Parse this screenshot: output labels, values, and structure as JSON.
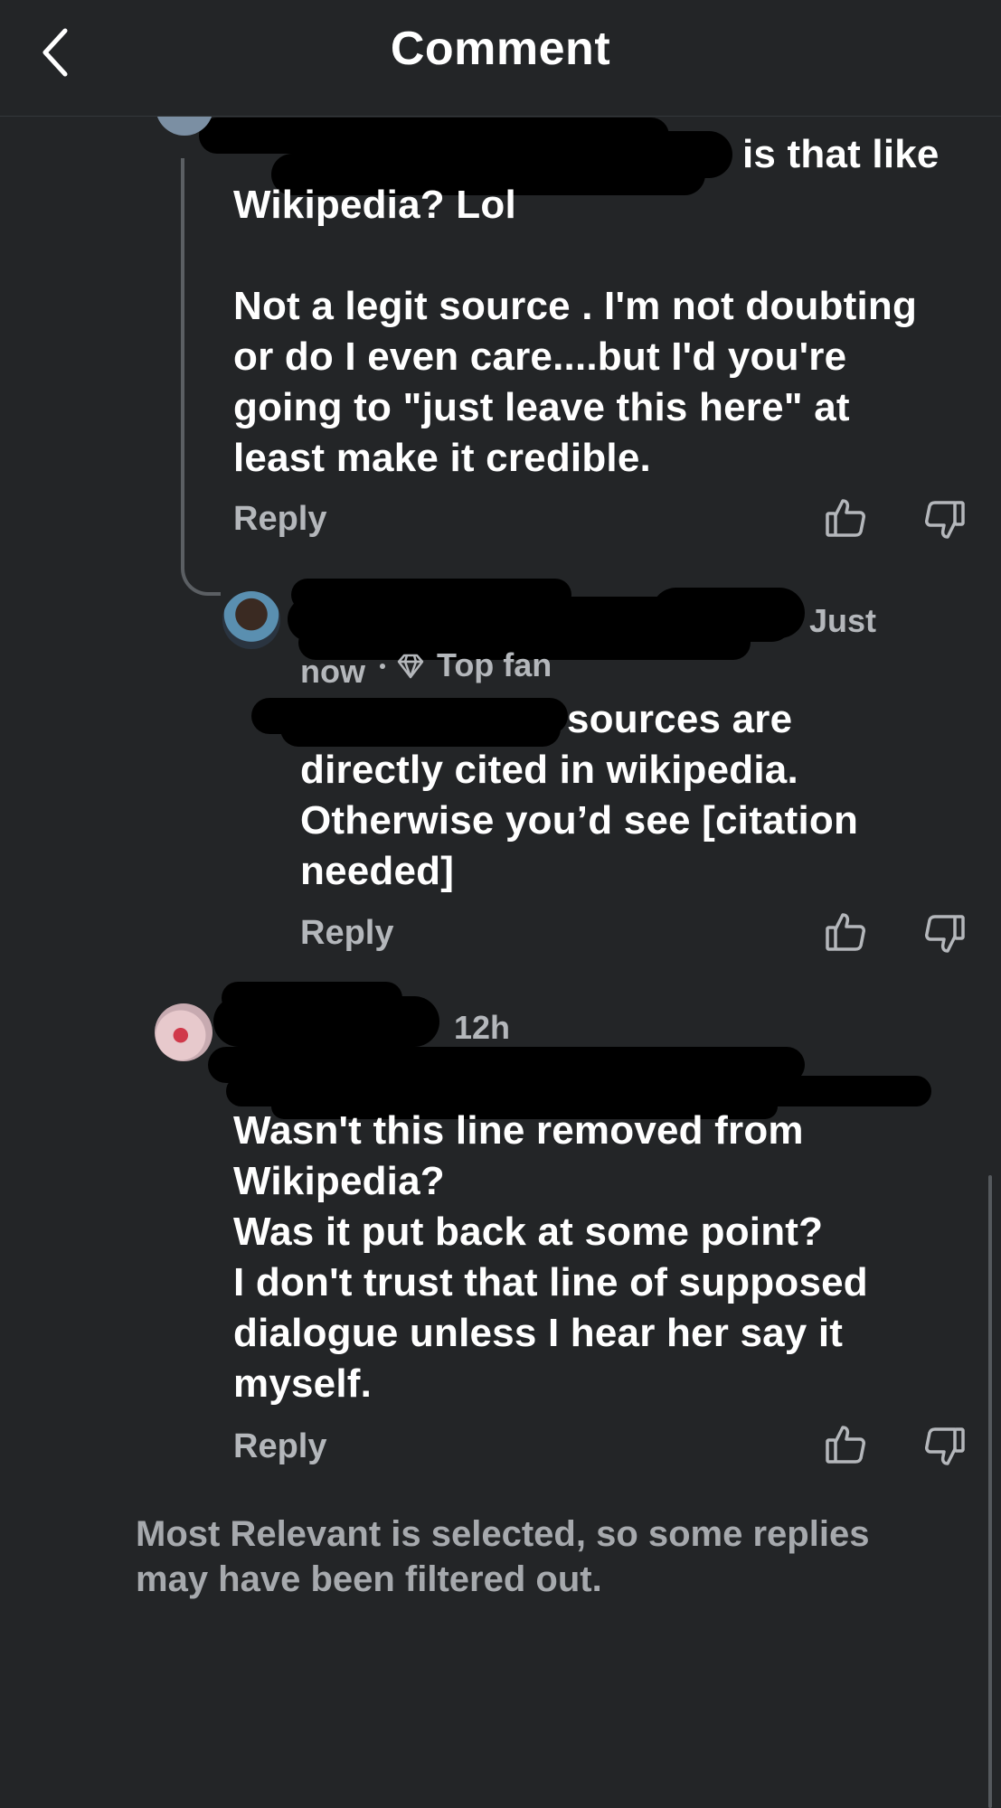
{
  "header": {
    "title": "Comment",
    "back_icon": "chevron-left-icon"
  },
  "comments": [
    {
      "text": "is that like\nWikipedia? Lol\n\nNot a legit source . I'm not doubting\nor do I even care....but I'd you're\ngoing to \"just leave this here\" at\nleast make it credible.",
      "reply_label": "Reply",
      "like_icon": "thumbs-up-icon",
      "dislike_icon": "thumbs-down-icon"
    },
    {
      "time": "Just\nnow",
      "badge_icon": "diamond-icon",
      "badge": "Top fan",
      "text": "sources are\ndirectly cited in wikipedia.\nOtherwise you’d see [citation\nneeded]",
      "reply_label": "Reply",
      "like_icon": "thumbs-up-icon",
      "dislike_icon": "thumbs-down-icon"
    },
    {
      "time": "12h",
      "text": "Wasn't this line removed from\nWikipedia?\nWas it put back at some point?\nI don't trust that line of supposed\ndialogue unless I hear her say it\nmyself.",
      "reply_label": "Reply",
      "like_icon": "thumbs-up-icon",
      "dislike_icon": "thumbs-down-icon"
    }
  ],
  "footer_note": "Most Relevant is selected, so some replies may have been filtered out.",
  "colors": {
    "background": "#232527",
    "text": "#ffffff",
    "muted": "#b4b7bb",
    "redaction": "#000000"
  }
}
